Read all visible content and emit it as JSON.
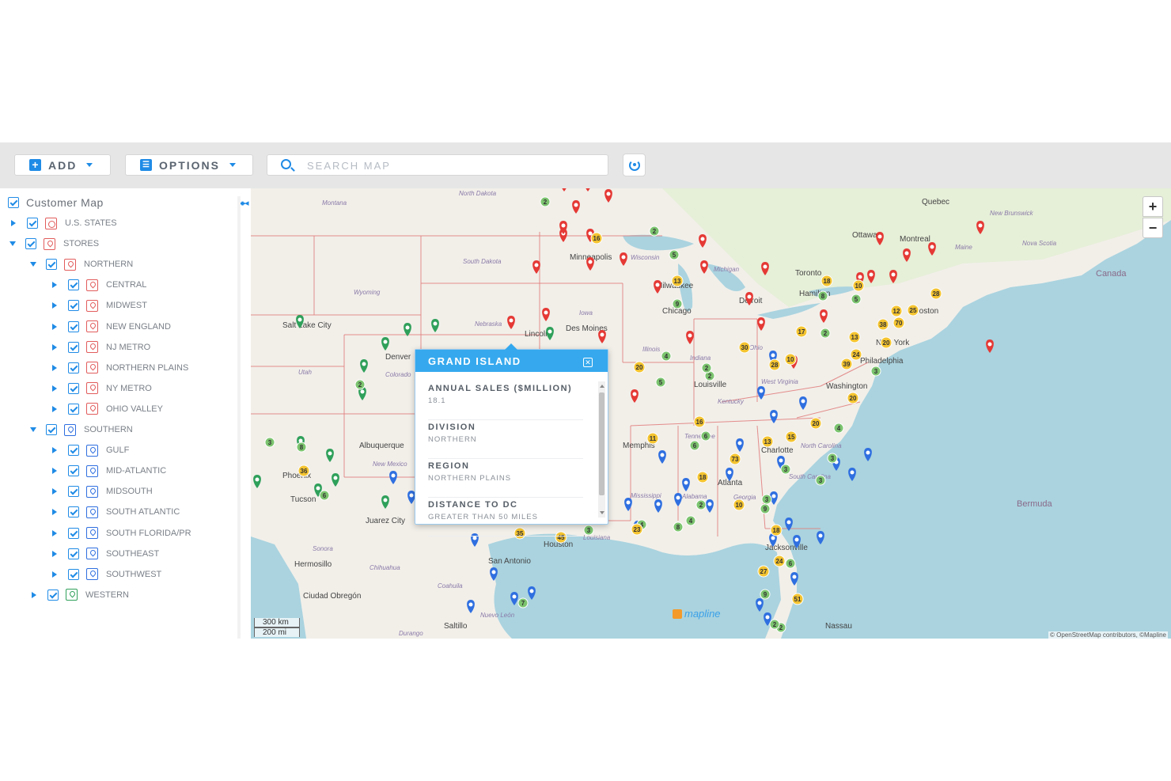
{
  "toolbar": {
    "add_label": "ADD",
    "options_label": "OPTIONS",
    "search_placeholder": "SEARCH MAP"
  },
  "sidebar": {
    "title": "Customer Map",
    "items": [
      {
        "label": "U.S. STATES",
        "depth": 1,
        "expanded": false,
        "color": "#e25c5c"
      },
      {
        "label": "STORES",
        "depth": 1,
        "expanded": true,
        "color": "#e25c5c"
      },
      {
        "label": "NORTHERN",
        "depth": 2,
        "expanded": true,
        "color": "#e25c5c"
      },
      {
        "label": "CENTRAL",
        "depth": 3,
        "expanded": false,
        "color": "#e25c5c"
      },
      {
        "label": "MIDWEST",
        "depth": 3,
        "expanded": false,
        "color": "#e25c5c"
      },
      {
        "label": "NEW ENGLAND",
        "depth": 3,
        "expanded": false,
        "color": "#e25c5c"
      },
      {
        "label": "NJ METRO",
        "depth": 3,
        "expanded": false,
        "color": "#e25c5c"
      },
      {
        "label": "NORTHERN PLAINS",
        "depth": 3,
        "expanded": false,
        "color": "#e25c5c"
      },
      {
        "label": "NY METRO",
        "depth": 3,
        "expanded": false,
        "color": "#e25c5c"
      },
      {
        "label": "OHIO VALLEY",
        "depth": 3,
        "expanded": false,
        "color": "#e25c5c"
      },
      {
        "label": "SOUTHERN",
        "depth": 2,
        "expanded": true,
        "color": "#2f6fe0"
      },
      {
        "label": "GULF",
        "depth": 3,
        "expanded": false,
        "color": "#2f6fe0"
      },
      {
        "label": "MID-ATLANTIC",
        "depth": 3,
        "expanded": false,
        "color": "#2f6fe0"
      },
      {
        "label": "MIDSOUTH",
        "depth": 3,
        "expanded": false,
        "color": "#2f6fe0"
      },
      {
        "label": "SOUTH ATLANTIC",
        "depth": 3,
        "expanded": false,
        "color": "#2f6fe0"
      },
      {
        "label": "SOUTH FLORIDA/PR",
        "depth": 3,
        "expanded": false,
        "color": "#2f6fe0"
      },
      {
        "label": "SOUTHEAST",
        "depth": 3,
        "expanded": false,
        "color": "#2f6fe0"
      },
      {
        "label": "SOUTHWEST",
        "depth": 3,
        "expanded": false,
        "color": "#2f6fe0"
      },
      {
        "label": "WESTERN",
        "depth": 2,
        "expanded": false,
        "color": "#2fa05a"
      }
    ]
  },
  "popup": {
    "title": "GRAND ISLAND",
    "fields": [
      {
        "key": "ANNUAL SALES ($MILLION)",
        "value": "18.1"
      },
      {
        "key": "DIVISION",
        "value": "NORTHERN"
      },
      {
        "key": "REGION",
        "value": "NORTHERN PLAINS"
      },
      {
        "key": "DISTANCE TO DC",
        "value": "GREATER THAN 50 MILES"
      }
    ]
  },
  "map": {
    "zoom_in": "+",
    "zoom_out": "−",
    "scale_km": "300 km",
    "scale_mi": "200 mi",
    "attribution": "© OpenStreetMap contributors, ©Mapline",
    "brand": "mapline",
    "places": [
      "Quebec",
      "Ottawa",
      "Montreal",
      "Toronto",
      "Hamilton",
      "Minneapolis",
      "Milwaukee",
      "Chicago",
      "Detroit",
      "Des Moines",
      "Lincoln",
      "Denver",
      "Albuquerque",
      "Phoenix",
      "Tucson",
      "Juarez City",
      "Hermosillo",
      "Ciudad Obregón",
      "Saltillo",
      "San Antonio",
      "Houston",
      "Memphis",
      "Atlanta",
      "Charlotte",
      "Jacksonville",
      "Washington",
      "Philadelphia",
      "New York",
      "Boston",
      "Louisville",
      "Salt Lake City",
      "Nassau"
    ],
    "regions": [
      "Montana",
      "North Dakota",
      "South Dakota",
      "Wyoming",
      "Nebraska",
      "Utah",
      "Colorado",
      "Iowa",
      "Illinois",
      "Indiana",
      "Ohio",
      "Wisconsin",
      "Michigan",
      "Kentucky",
      "Tennessee",
      "Alabama",
      "Georgia",
      "Mississippi",
      "Louisiana",
      "New Mexico",
      "Sonora",
      "Chihuahua",
      "Coahuila",
      "Nuevo León",
      "Durango",
      "North Carolina",
      "South Carolina",
      "West Virginia",
      "Maine",
      "New Brunswick",
      "Nova Scotia"
    ],
    "countries_seas": [
      "Canada",
      "Bermuda"
    ],
    "cluster_badges": [
      "2",
      "16",
      "2",
      "5",
      "13",
      "9",
      "2",
      "5",
      "6",
      "2",
      "4",
      "36",
      "8",
      "3",
      "6",
      "2",
      "11",
      "16",
      "6",
      "73",
      "18",
      "10",
      "13",
      "15",
      "20",
      "4",
      "3",
      "3",
      "3",
      "2",
      "4",
      "8",
      "4",
      "23",
      "35",
      "45",
      "3",
      "7",
      "18",
      "27",
      "24",
      "6",
      "9",
      "51",
      "2",
      "30",
      "20",
      "17",
      "2",
      "10",
      "28",
      "18",
      "8",
      "10",
      "5",
      "28",
      "12",
      "25",
      "70",
      "38",
      "20",
      "39",
      "24",
      "3",
      "13",
      "20",
      "3",
      "9",
      "2"
    ]
  },
  "colors": {
    "accent": "#1f8be6",
    "popup_header": "#36a9ee",
    "northern_pin": "#e53935",
    "southern_pin": "#2f6fe0",
    "western_pin": "#2fa05a",
    "cluster": "#f4c430",
    "water": "#aad3df",
    "land": "#f2efe9",
    "border": "#e07a7a"
  }
}
